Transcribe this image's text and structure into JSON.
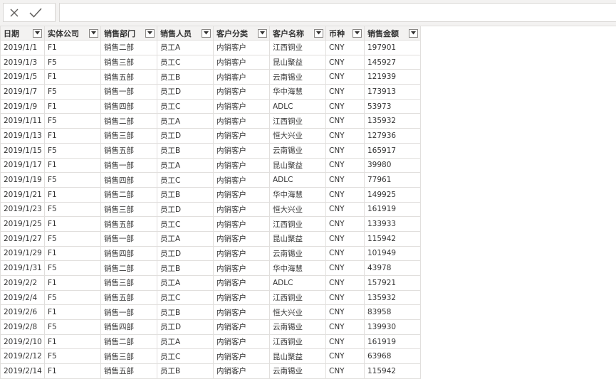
{
  "icons": {
    "cancel": "close-icon",
    "confirm": "checkmark-icon",
    "filter": "chevron-down-icon"
  },
  "formula_bar": {
    "value": ""
  },
  "columns": [
    "日期",
    "实体公司",
    "销售部门",
    "销售人员",
    "客户分类",
    "客户名称",
    "币种",
    "销售金额"
  ],
  "rows": [
    [
      "2019/1/1",
      "F1",
      "销售二部",
      "员工A",
      "内销客户",
      "江西铜业",
      "CNY",
      "197901"
    ],
    [
      "2019/1/3",
      "F5",
      "销售三部",
      "员工C",
      "内销客户",
      "昆山聚益",
      "CNY",
      "145927"
    ],
    [
      "2019/1/5",
      "F1",
      "销售五部",
      "员工B",
      "内销客户",
      "云南锡业",
      "CNY",
      "121939"
    ],
    [
      "2019/1/7",
      "F5",
      "销售一部",
      "员工D",
      "内销客户",
      "华中海慧",
      "CNY",
      "173913"
    ],
    [
      "2019/1/9",
      "F1",
      "销售四部",
      "员工C",
      "内销客户",
      "ADLC",
      "CNY",
      "53973"
    ],
    [
      "2019/1/11",
      "F5",
      "销售二部",
      "员工A",
      "内销客户",
      "江西铜业",
      "CNY",
      "135932"
    ],
    [
      "2019/1/13",
      "F1",
      "销售三部",
      "员工D",
      "内销客户",
      "恒大兴业",
      "CNY",
      "127936"
    ],
    [
      "2019/1/15",
      "F5",
      "销售五部",
      "员工B",
      "内销客户",
      "云南锡业",
      "CNY",
      "165917"
    ],
    [
      "2019/1/17",
      "F1",
      "销售一部",
      "员工A",
      "内销客户",
      "昆山聚益",
      "CNY",
      "39980"
    ],
    [
      "2019/1/19",
      "F5",
      "销售四部",
      "员工C",
      "内销客户",
      "ADLC",
      "CNY",
      "77961"
    ],
    [
      "2019/1/21",
      "F1",
      "销售二部",
      "员工B",
      "内销客户",
      "华中海慧",
      "CNY",
      "149925"
    ],
    [
      "2019/1/23",
      "F5",
      "销售三部",
      "员工D",
      "内销客户",
      "恒大兴业",
      "CNY",
      "161919"
    ],
    [
      "2019/1/25",
      "F1",
      "销售五部",
      "员工C",
      "内销客户",
      "江西铜业",
      "CNY",
      "133933"
    ],
    [
      "2019/1/27",
      "F5",
      "销售一部",
      "员工A",
      "内销客户",
      "昆山聚益",
      "CNY",
      "115942"
    ],
    [
      "2019/1/29",
      "F1",
      "销售四部",
      "员工D",
      "内销客户",
      "云南锡业",
      "CNY",
      "101949"
    ],
    [
      "2019/1/31",
      "F5",
      "销售二部",
      "员工B",
      "内销客户",
      "华中海慧",
      "CNY",
      "43978"
    ],
    [
      "2019/2/2",
      "F1",
      "销售三部",
      "员工A",
      "内销客户",
      "ADLC",
      "CNY",
      "157921"
    ],
    [
      "2019/2/4",
      "F5",
      "销售五部",
      "员工C",
      "内销客户",
      "江西铜业",
      "CNY",
      "135932"
    ],
    [
      "2019/2/6",
      "F1",
      "销售一部",
      "员工B",
      "内销客户",
      "恒大兴业",
      "CNY",
      "83958"
    ],
    [
      "2019/2/8",
      "F5",
      "销售四部",
      "员工D",
      "内销客户",
      "云南锡业",
      "CNY",
      "139930"
    ],
    [
      "2019/2/10",
      "F1",
      "销售二部",
      "员工A",
      "内销客户",
      "江西铜业",
      "CNY",
      "161919"
    ],
    [
      "2019/2/12",
      "F5",
      "销售三部",
      "员工C",
      "内销客户",
      "昆山聚益",
      "CNY",
      "63968"
    ],
    [
      "2019/2/14",
      "F1",
      "销售五部",
      "员工B",
      "内销客户",
      "云南锡业",
      "CNY",
      "115942"
    ]
  ]
}
